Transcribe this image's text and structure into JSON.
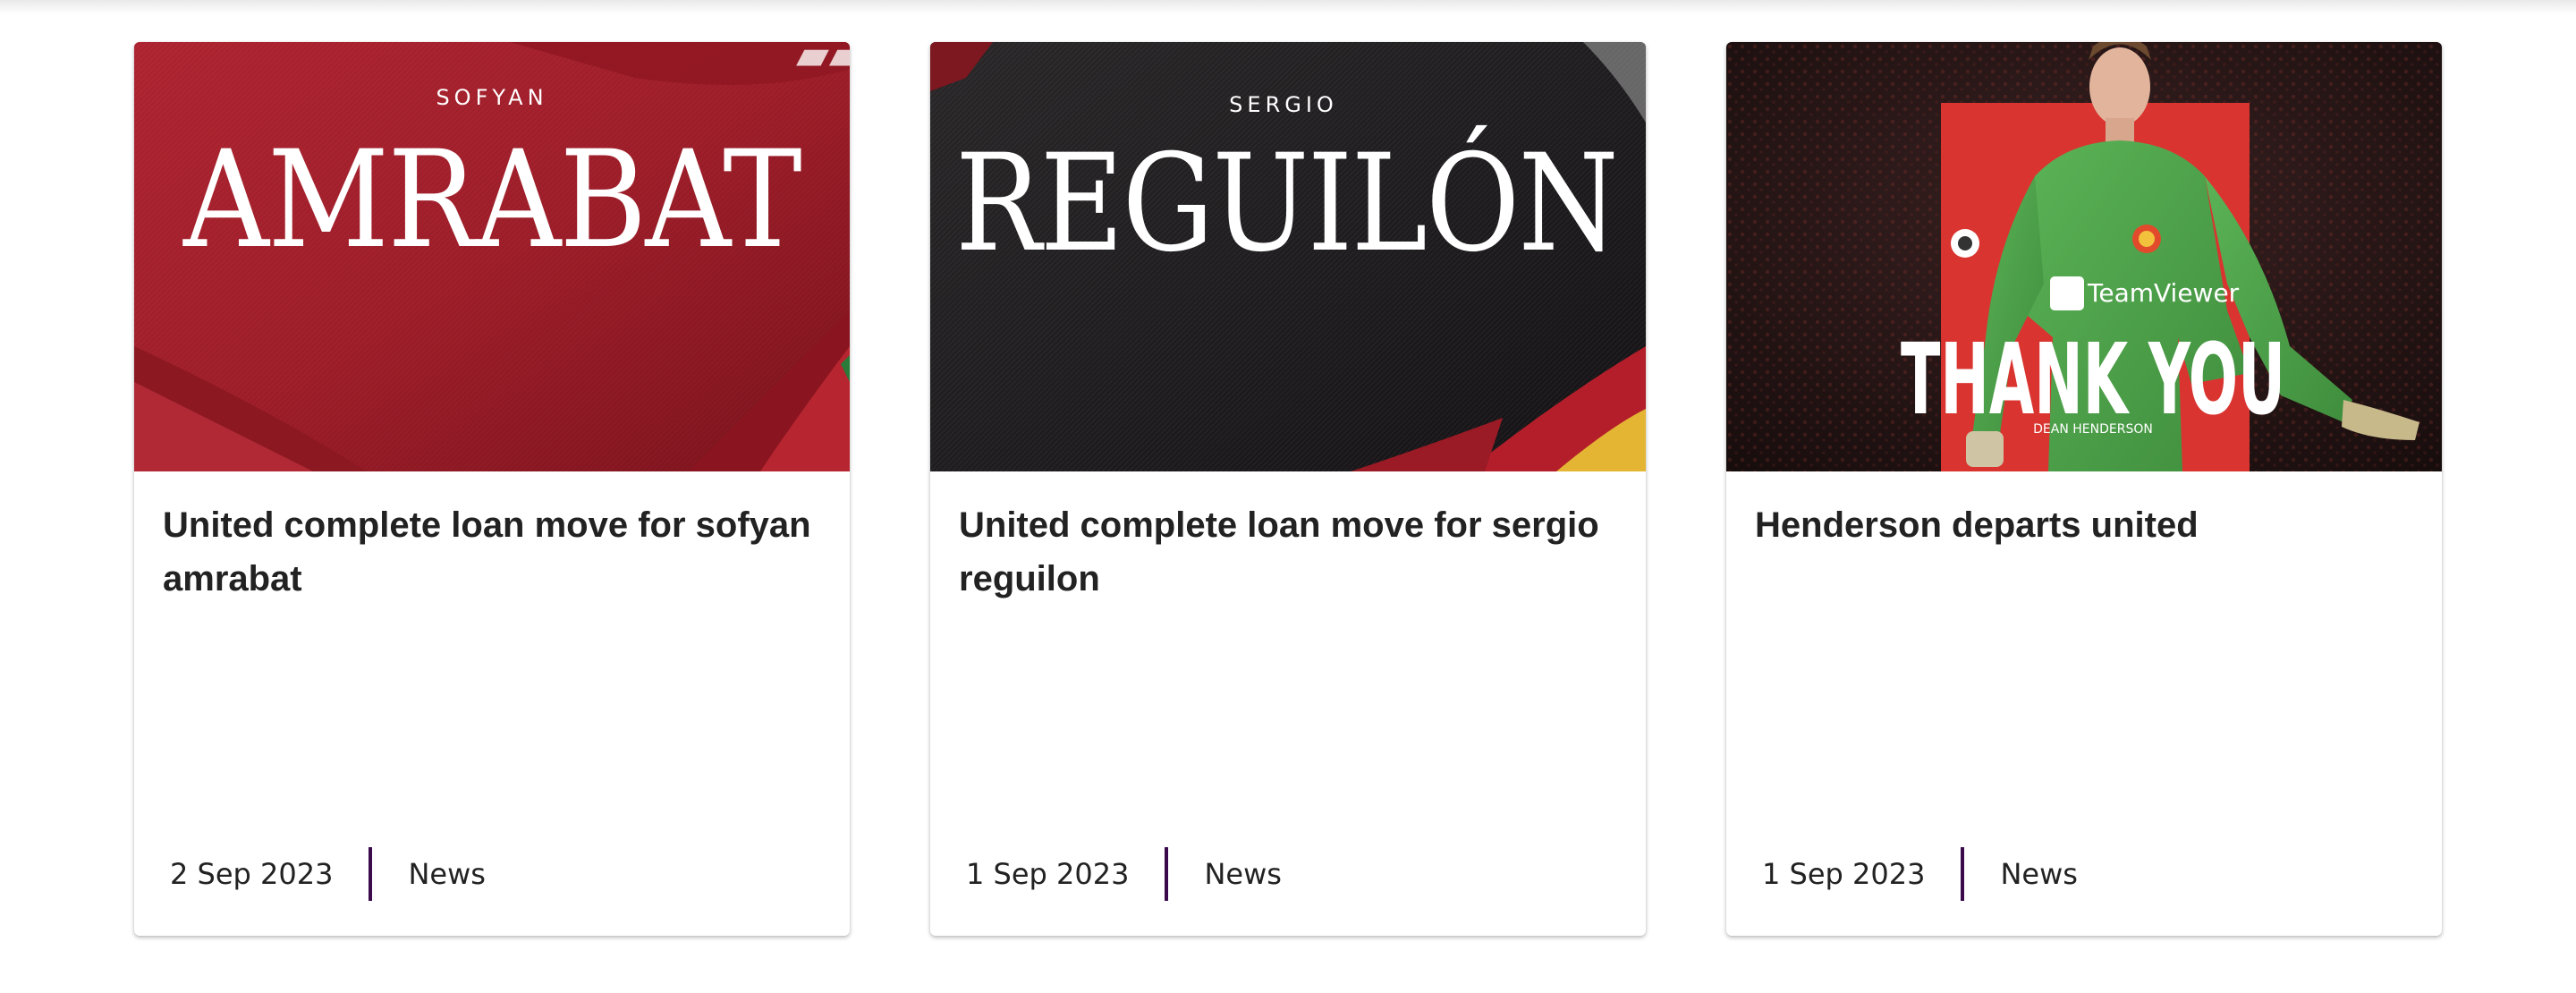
{
  "cards": [
    {
      "title": "United complete loan move for sofyan amrabat",
      "date": "2 Sep 2023",
      "category": "News",
      "image": {
        "first_name": "SOFYAN",
        "last_name": "AMRABAT",
        "background": "red jersey fabric"
      }
    },
    {
      "title": "United complete loan move for sergio reguilon",
      "date": "1 Sep 2023",
      "category": "News",
      "image": {
        "first_name": "SERGIO",
        "last_name": "REGUILÓN",
        "background": "black jersey fabric"
      }
    },
    {
      "title": "Henderson departs united",
      "date": "1 Sep 2023",
      "category": "News",
      "image": {
        "headline": "THANK YOU",
        "caption": "DEAN HENDERSON",
        "sponsor": "TeamViewer",
        "background": "goalkeeper in green kit on red panel"
      }
    }
  ],
  "colors": {
    "divider": "#3a0a4c",
    "title": "#222222",
    "jersey_red": "#a31f2a",
    "jersey_black": "#1c1a1c",
    "kit_green": "#4fa24c"
  }
}
